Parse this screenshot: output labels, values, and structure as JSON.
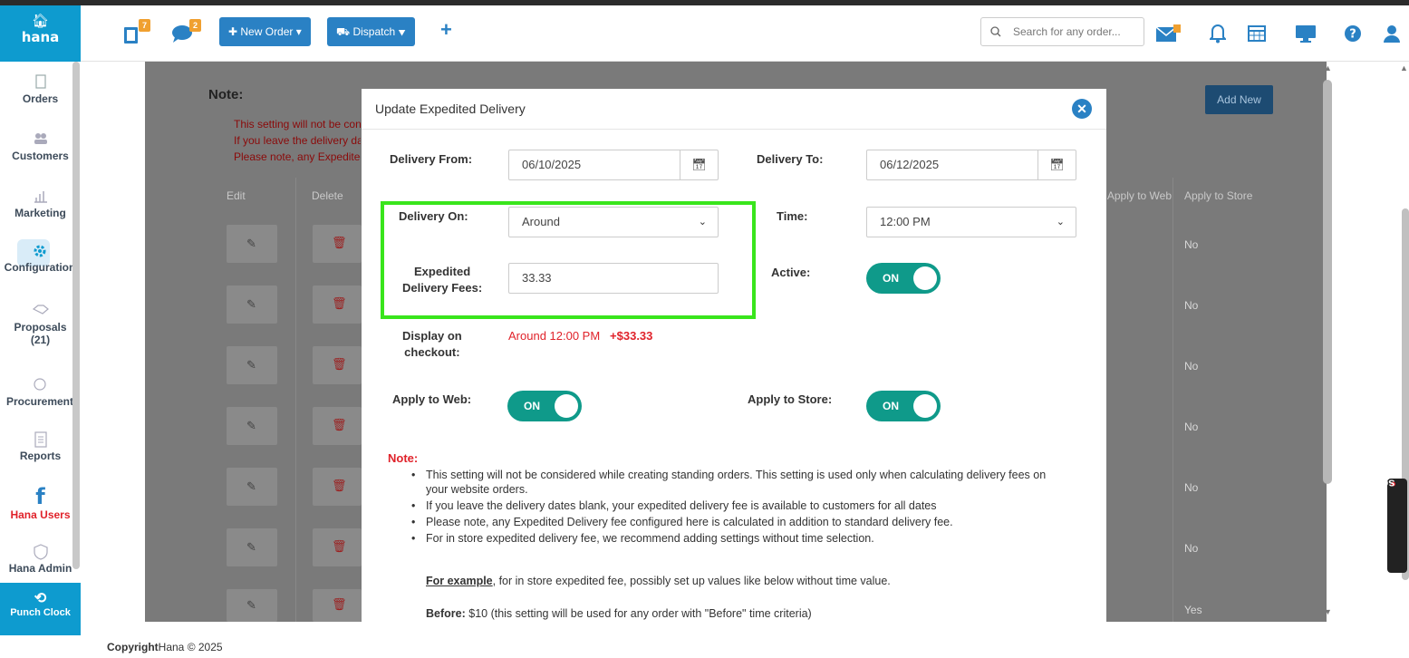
{
  "topbar": {
    "logo_text": "hana",
    "orders_badge": "7",
    "chat_badge": "2",
    "new_order_label": "New Order",
    "dispatch_label": "Dispatch",
    "search_placeholder": "Search for any order..."
  },
  "sidebar": {
    "items": [
      {
        "label": "Orders"
      },
      {
        "label": "Customers"
      },
      {
        "label": "Marketing"
      },
      {
        "label": "Configuration"
      },
      {
        "label": "Proposals",
        "count": "(21)"
      },
      {
        "label": "Procurement"
      },
      {
        "label": "Reports"
      },
      {
        "label": "Hana Users"
      },
      {
        "label": "Hana Admin"
      }
    ],
    "punch_clock": "Punch Clock"
  },
  "background": {
    "note_title": "Note:",
    "notes": [
      "This setting will not be considered",
      "If you leave the delivery dates",
      "Please note, any Expedited"
    ],
    "add_new": "Add New",
    "columns": [
      "Edit",
      "Delete",
      "Apply to Web",
      "Apply to Store"
    ],
    "rows": [
      "No",
      "No",
      "No",
      "No",
      "No",
      "No",
      "Yes"
    ]
  },
  "modal": {
    "title": "Update Expedited Delivery",
    "delivery_from_label": "Delivery From:",
    "delivery_from_value": "06/10/2025",
    "delivery_to_label": "Delivery To:",
    "delivery_to_value": "06/12/2025",
    "delivery_on_label": "Delivery On:",
    "delivery_on_value": "Around",
    "time_label": "Time:",
    "time_value": "12:00 PM",
    "fees_label_1": "Expedited",
    "fees_label_2": "Delivery Fees:",
    "fees_value": "33.33",
    "active_label": "Active:",
    "active_state": "ON",
    "display_label_1": "Display on",
    "display_label_2": "checkout:",
    "display_value": "Around 12:00 PM",
    "display_fee": "+$33.33",
    "apply_web_label": "Apply to Web:",
    "apply_web_state": "ON",
    "apply_store_label": "Apply to Store:",
    "apply_store_state": "ON",
    "note_title": "Note:",
    "notes": [
      "This setting will not be considered while creating standing orders. This setting is used only when calculating delivery fees on your website orders.",
      "If you leave the delivery dates blank, your expedited delivery fee is available to customers for all dates",
      "Please note, any Expedited Delivery fee configured here is calculated in addition to standard delivery fee.",
      "For in store expedited delivery fee, we recommend adding settings without time selection."
    ],
    "example_lead": "For example",
    "example_text": ", for in store expedited fee, possibly set up values like below without time value.",
    "before_label": "Before:",
    "before_text": " $10 (this setting will be used for any order with \"Before\" time criteria)"
  },
  "footer": {
    "copyright_bold": "Copyright",
    "copyright_text": "Hana © 2025"
  },
  "screenrec_label": "screenrec",
  "colors": {
    "brand": "#0e9bcf",
    "button": "#2a81c4",
    "toggle": "#0f9a8a",
    "highlight": "#39e51c",
    "note_red": "#e0222a"
  }
}
